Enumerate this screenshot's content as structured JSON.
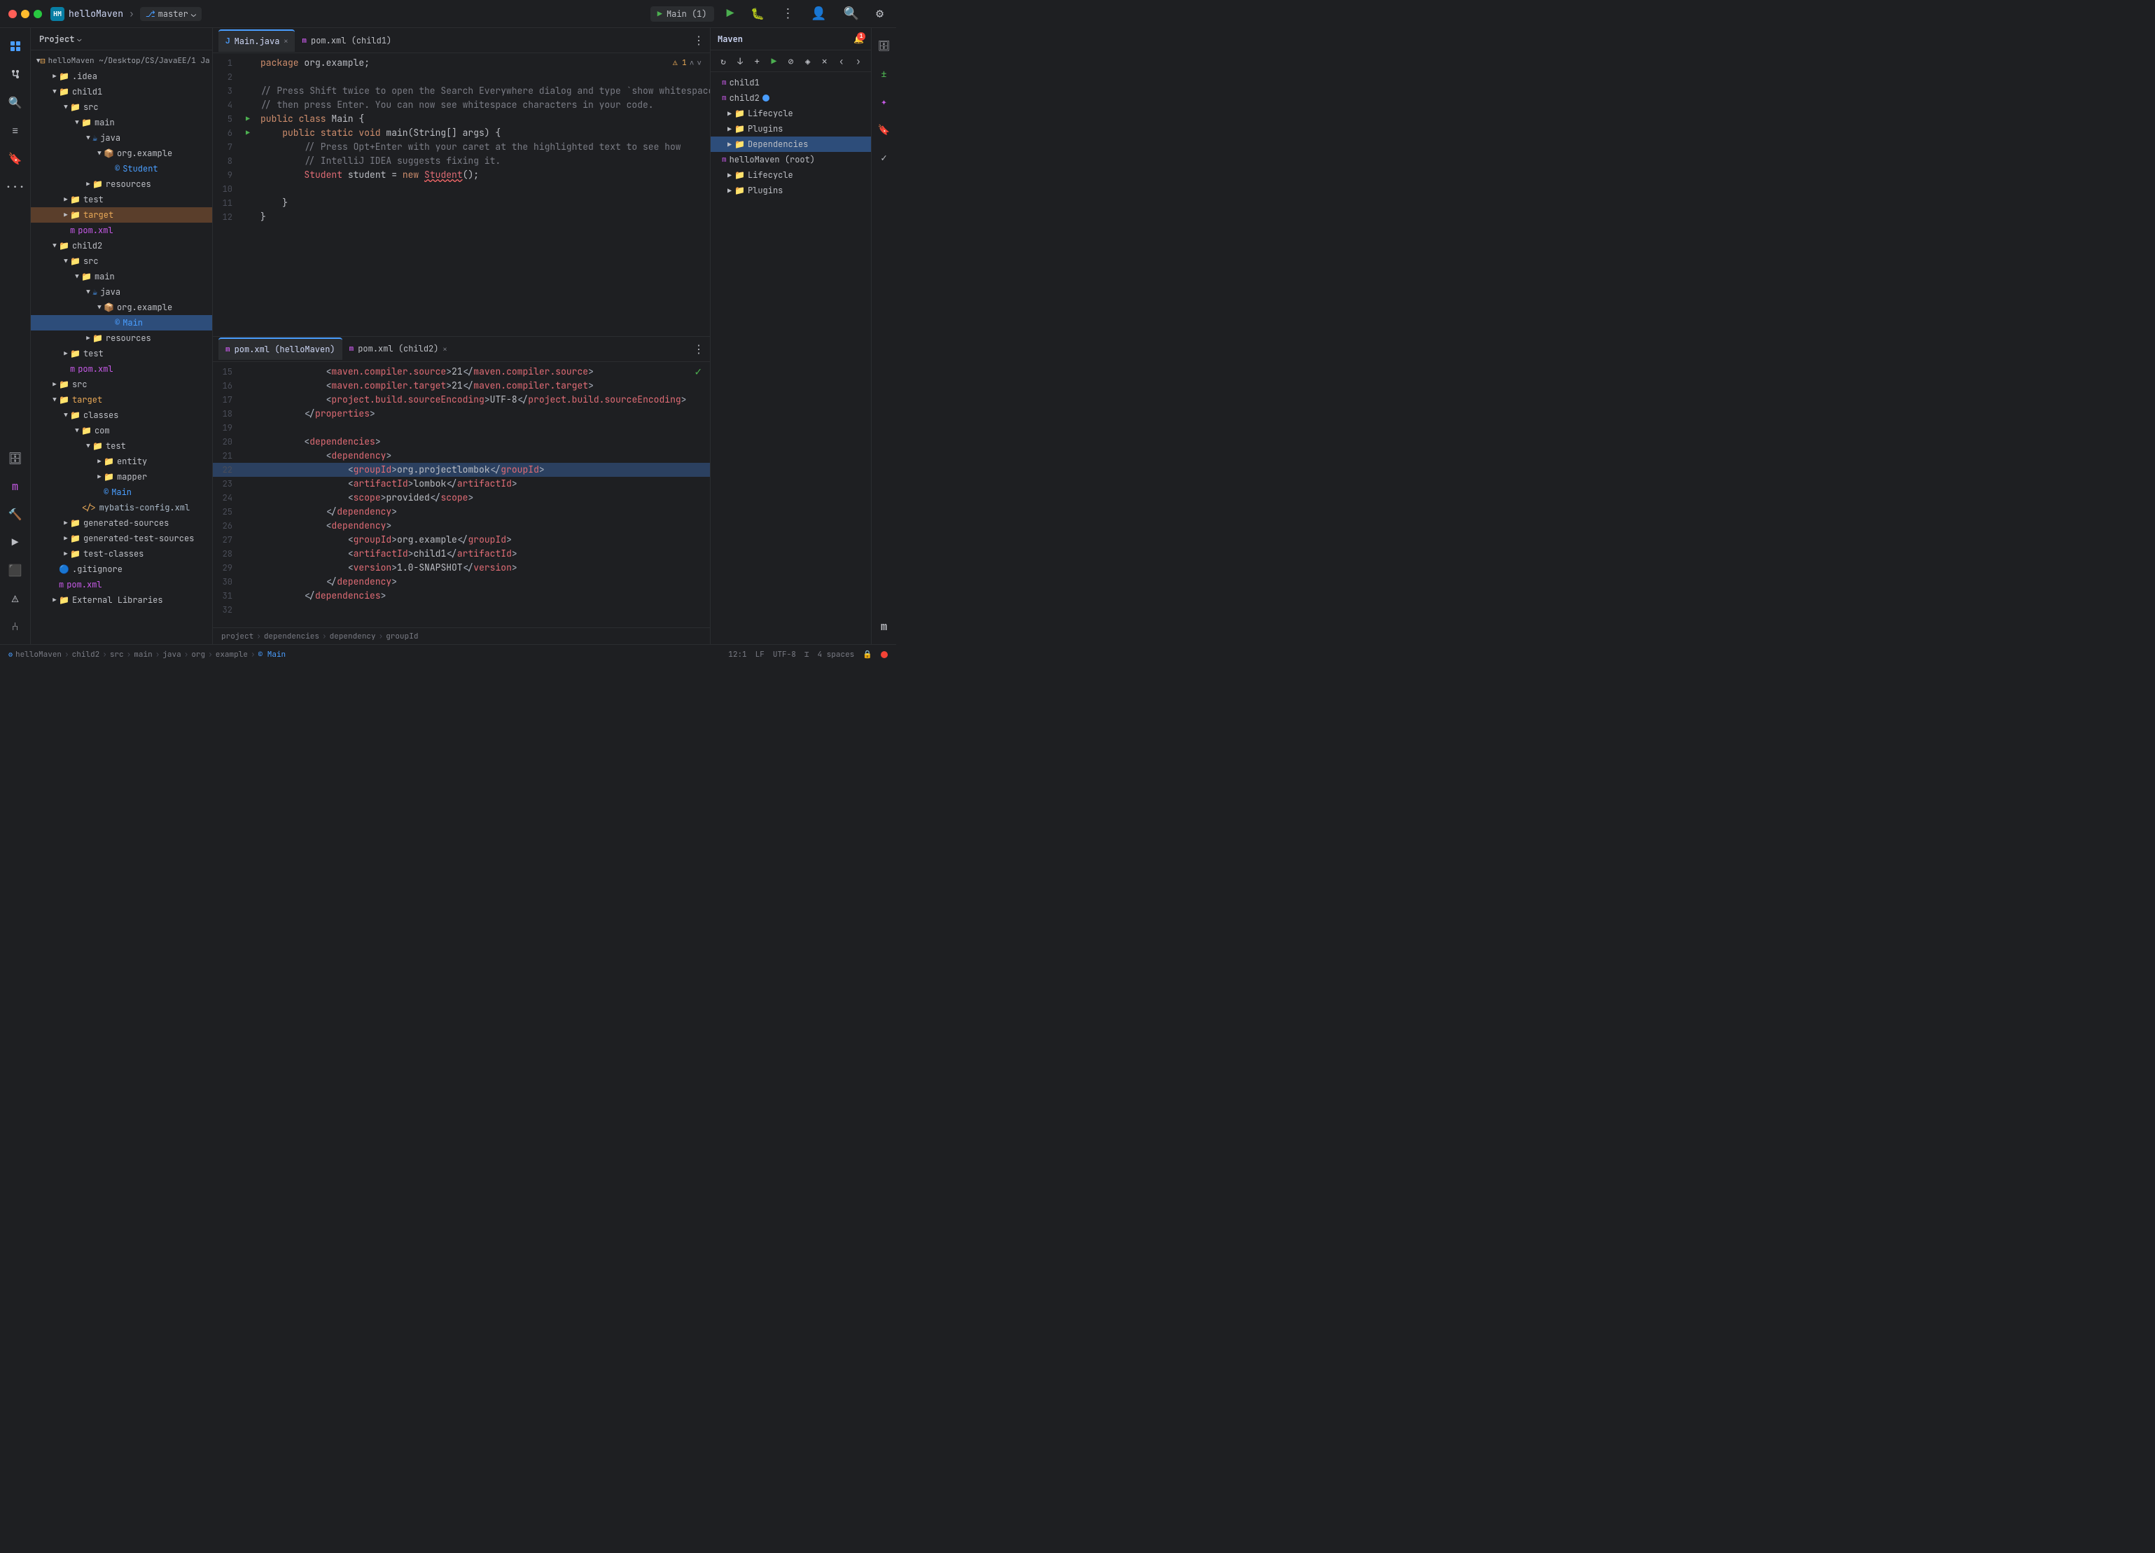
{
  "titlebar": {
    "app_icon": "HM",
    "project_name": "helloMaven",
    "branch": "master",
    "run_label": "Main (1)",
    "run_config": "▶"
  },
  "file_tree": {
    "panel_title": "Project",
    "items": [
      {
        "id": "hellomaven-root",
        "label": "helloMaven ~/Desktop/CS/JavaEE/1 Ja...",
        "indent": 0,
        "type": "root",
        "expanded": true
      },
      {
        "id": "idea",
        "label": ".idea",
        "indent": 1,
        "type": "folder",
        "expanded": false
      },
      {
        "id": "child1",
        "label": "child1",
        "indent": 1,
        "type": "folder",
        "expanded": true
      },
      {
        "id": "child1-src",
        "label": "src",
        "indent": 2,
        "type": "folder",
        "expanded": true
      },
      {
        "id": "child1-main",
        "label": "main",
        "indent": 3,
        "type": "folder",
        "expanded": true
      },
      {
        "id": "child1-java",
        "label": "java",
        "indent": 4,
        "type": "java-src",
        "expanded": true
      },
      {
        "id": "child1-org-example",
        "label": "org.example",
        "indent": 5,
        "type": "package",
        "expanded": true
      },
      {
        "id": "child1-student",
        "label": "Student",
        "indent": 6,
        "type": "java-class"
      },
      {
        "id": "child1-resources",
        "label": "resources",
        "indent": 4,
        "type": "resources"
      },
      {
        "id": "child1-test",
        "label": "test",
        "indent": 2,
        "type": "folder",
        "expanded": false
      },
      {
        "id": "child1-target",
        "label": "target",
        "indent": 2,
        "type": "folder-target",
        "expanded": false,
        "selected": true
      },
      {
        "id": "child1-pom",
        "label": "pom.xml",
        "indent": 2,
        "type": "maven"
      },
      {
        "id": "child2",
        "label": "child2",
        "indent": 1,
        "type": "folder",
        "expanded": true
      },
      {
        "id": "child2-src",
        "label": "src",
        "indent": 2,
        "type": "folder",
        "expanded": true
      },
      {
        "id": "child2-main",
        "label": "main",
        "indent": 3,
        "type": "folder",
        "expanded": true
      },
      {
        "id": "child2-java",
        "label": "java",
        "indent": 4,
        "type": "java-src",
        "expanded": true
      },
      {
        "id": "child2-org-example",
        "label": "org.example",
        "indent": 5,
        "type": "package",
        "expanded": true
      },
      {
        "id": "child2-main-class",
        "label": "Main",
        "indent": 6,
        "type": "java-class",
        "active": true
      },
      {
        "id": "child2-resources",
        "label": "resources",
        "indent": 4,
        "type": "resources"
      },
      {
        "id": "child2-test",
        "label": "test",
        "indent": 2,
        "type": "folder",
        "expanded": false
      },
      {
        "id": "child2-pom",
        "label": "pom.xml",
        "indent": 2,
        "type": "maven"
      },
      {
        "id": "src",
        "label": "src",
        "indent": 1,
        "type": "folder",
        "expanded": false
      },
      {
        "id": "target",
        "label": "target",
        "indent": 1,
        "type": "folder-target",
        "expanded": true
      },
      {
        "id": "classes",
        "label": "classes",
        "indent": 2,
        "type": "folder",
        "expanded": true
      },
      {
        "id": "com",
        "label": "com",
        "indent": 3,
        "type": "folder",
        "expanded": true
      },
      {
        "id": "test-folder",
        "label": "test",
        "indent": 4,
        "type": "folder",
        "expanded": true
      },
      {
        "id": "entity",
        "label": "entity",
        "indent": 5,
        "type": "folder"
      },
      {
        "id": "mapper",
        "label": "mapper",
        "indent": 5,
        "type": "folder"
      },
      {
        "id": "main-class",
        "label": "Main",
        "indent": 5,
        "type": "java-class"
      },
      {
        "id": "mybatis-config",
        "label": "mybatis-config.xml",
        "indent": 3,
        "type": "xml"
      },
      {
        "id": "generated-sources",
        "label": "generated-sources",
        "indent": 2,
        "type": "folder"
      },
      {
        "id": "generated-test-sources",
        "label": "generated-test-sources",
        "indent": 2,
        "type": "folder"
      },
      {
        "id": "test-classes",
        "label": "test-classes",
        "indent": 2,
        "type": "folder"
      },
      {
        "id": "gitignore",
        "label": ".gitignore",
        "indent": 1,
        "type": "file"
      },
      {
        "id": "root-pom",
        "label": "pom.xml",
        "indent": 1,
        "type": "maven"
      },
      {
        "id": "external-libs",
        "label": "External Libraries",
        "indent": 1,
        "type": "folder"
      }
    ]
  },
  "editor": {
    "tabs_top": [
      {
        "id": "main-java",
        "label": "Main.java",
        "type": "java",
        "active": true,
        "closeable": true
      },
      {
        "id": "pom-child1",
        "label": "pom.xml (child1)",
        "type": "maven",
        "active": false,
        "closeable": false
      }
    ],
    "tabs_bottom": [
      {
        "id": "pom-hellomaven",
        "label": "pom.xml (helloMaven)",
        "type": "maven",
        "active": true,
        "closeable": false
      },
      {
        "id": "pom-child2",
        "label": "pom.xml (child2)",
        "type": "maven",
        "active": false,
        "closeable": true
      }
    ],
    "top_lines": [
      {
        "num": 1,
        "content": "package org.example;",
        "run": false
      },
      {
        "num": 2,
        "content": "",
        "run": false
      },
      {
        "num": 3,
        "content": "// Press Shift twice to open the Search Everywhere dialog and type `show whitespaces`,",
        "run": false,
        "comment": true
      },
      {
        "num": 4,
        "content": "// then press Enter. You can now see whitespace characters in your code.",
        "run": false,
        "comment": true
      },
      {
        "num": 5,
        "content": "public class Main {",
        "run": true
      },
      {
        "num": 6,
        "content": "    public static void main(String[] args) {",
        "run": true
      },
      {
        "num": 7,
        "content": "        // Press Opt+Enter with your caret at the highlighted text to see how",
        "run": false,
        "comment": true
      },
      {
        "num": 8,
        "content": "        // IntelliJ IDEA suggests fixing it.",
        "run": false,
        "comment": true
      },
      {
        "num": 9,
        "content": "        Student student = new Student();",
        "run": false
      },
      {
        "num": 10,
        "content": "",
        "run": false
      },
      {
        "num": 11,
        "content": "    }",
        "run": false
      },
      {
        "num": 12,
        "content": "}",
        "run": false
      }
    ],
    "bottom_lines": [
      {
        "num": 15,
        "content": "            <maven.compiler.source>21</maven.compiler.source>"
      },
      {
        "num": 16,
        "content": "            <maven.compiler.target>21</maven.compiler.target>"
      },
      {
        "num": 17,
        "content": "            <project.build.sourceEncoding>UTF-8</project.build.sourceEncoding>"
      },
      {
        "num": 18,
        "content": "        </properties>"
      },
      {
        "num": 19,
        "content": ""
      },
      {
        "num": 20,
        "content": "        <dependencies>"
      },
      {
        "num": 21,
        "content": "            <dependency>",
        "gutter": true
      },
      {
        "num": 22,
        "content": "                <groupId>org.projectlombok</groupId>",
        "selected": true
      },
      {
        "num": 23,
        "content": "                <artifactId>lombok</artifactId>"
      },
      {
        "num": 24,
        "content": "                <scope>provided</scope>"
      },
      {
        "num": 25,
        "content": "            </dependency>"
      },
      {
        "num": 26,
        "content": "            <dependency>"
      },
      {
        "num": 27,
        "content": "                <groupId>org.example</groupId>"
      },
      {
        "num": 28,
        "content": "                <artifactId>child1</artifactId>"
      },
      {
        "num": 29,
        "content": "                <version>1.0-SNAPSHOT</version>"
      },
      {
        "num": 30,
        "content": "            </dependency>"
      },
      {
        "num": 31,
        "content": "        </dependencies>"
      },
      {
        "num": 32,
        "content": ""
      }
    ]
  },
  "maven_panel": {
    "title": "Maven",
    "items": [
      {
        "id": "child1",
        "label": "child1",
        "indent": 0,
        "expanded": false
      },
      {
        "id": "child2",
        "label": "child2",
        "indent": 0,
        "expanded": true,
        "badge": true
      },
      {
        "id": "lifecycle",
        "label": "Lifecycle",
        "indent": 1,
        "expanded": false
      },
      {
        "id": "plugins",
        "label": "Plugins",
        "indent": 1,
        "expanded": false
      },
      {
        "id": "dependencies",
        "label": "Dependencies",
        "indent": 1,
        "expanded": false,
        "active": true
      },
      {
        "id": "hellomaven-root",
        "label": "helloMaven (root)",
        "indent": 0,
        "expanded": true
      },
      {
        "id": "root-lifecycle",
        "label": "Lifecycle",
        "indent": 1,
        "expanded": false
      },
      {
        "id": "root-plugins",
        "label": "Plugins",
        "indent": 1,
        "expanded": false
      }
    ]
  },
  "statusbar": {
    "breadcrumb": [
      "helloMaven",
      ">",
      "child2",
      ">",
      "src",
      ">",
      "main",
      ">",
      "java",
      ">",
      "org",
      ">",
      "example",
      ">",
      "Main"
    ],
    "position": "12:1",
    "line_ending": "LF",
    "encoding": "UTF-8",
    "spaces": "4 spaces"
  },
  "bottom_breadcrumb": {
    "items": [
      "project",
      ">",
      "dependencies",
      ">",
      "dependency",
      ">",
      "groupId"
    ]
  }
}
